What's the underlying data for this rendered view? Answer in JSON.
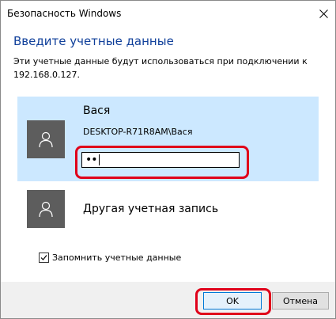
{
  "window": {
    "title": "Безопасность Windows"
  },
  "header": {
    "heading": "Введите учетные данные",
    "description": "Эти учетные данные будут использоваться при подключении к 192.168.0.127."
  },
  "accounts": [
    {
      "name": "Вася",
      "domain": "DESKTOP-R71R8AM\\Вася",
      "password_mask": "••",
      "selected": true
    },
    {
      "name": "Другая учетная запись",
      "selected": false
    }
  ],
  "options": {
    "remember_label": "Запомнить учетные данные",
    "remember_checked": true
  },
  "buttons": {
    "ok": "OK",
    "cancel": "Отмена"
  },
  "colors": {
    "selection": "#cce8ff",
    "heading": "#0f3f9a",
    "highlight": "#e0001a",
    "avatar": "#5d5d5d"
  }
}
